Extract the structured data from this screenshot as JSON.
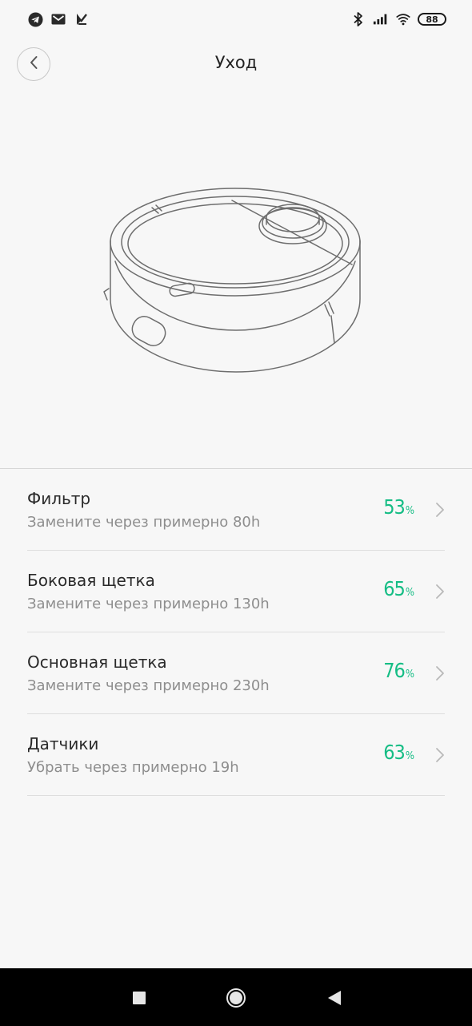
{
  "status_bar": {
    "left_icons": [
      "telegram-icon",
      "gmail-icon",
      "cast-icon"
    ],
    "right_icons": [
      "bluetooth-icon",
      "signal-icon",
      "wifi-icon"
    ],
    "battery": "88"
  },
  "header": {
    "title": "Уход",
    "back_icon": "chevron-left-icon"
  },
  "illustration": {
    "icon": "robot-vacuum-illustration"
  },
  "items": [
    {
      "title": "Фильтр",
      "subtitle": "Замените через примерно 80h",
      "percent_value": "53",
      "percent_sign": "%",
      "percent_remaining": 53
    },
    {
      "title": "Боковая щетка",
      "subtitle": "Замените через примерно 130h",
      "percent_value": "65",
      "percent_sign": "%",
      "percent_remaining": 65
    },
    {
      "title": "Основная щетка",
      "subtitle": "Замените через примерно 230h",
      "percent_value": "76",
      "percent_sign": "%",
      "percent_remaining": 76
    },
    {
      "title": "Датчики",
      "subtitle": "Убрать через примерно 19h",
      "percent_value": "63",
      "percent_sign": "%",
      "percent_remaining": 63
    }
  ],
  "colors": {
    "accent": "#16bd85",
    "background": "#f7f7f7",
    "nav_bar": "#000000"
  },
  "nav_bar": {
    "icons": [
      "recent-apps-icon",
      "home-icon",
      "back-icon"
    ]
  }
}
